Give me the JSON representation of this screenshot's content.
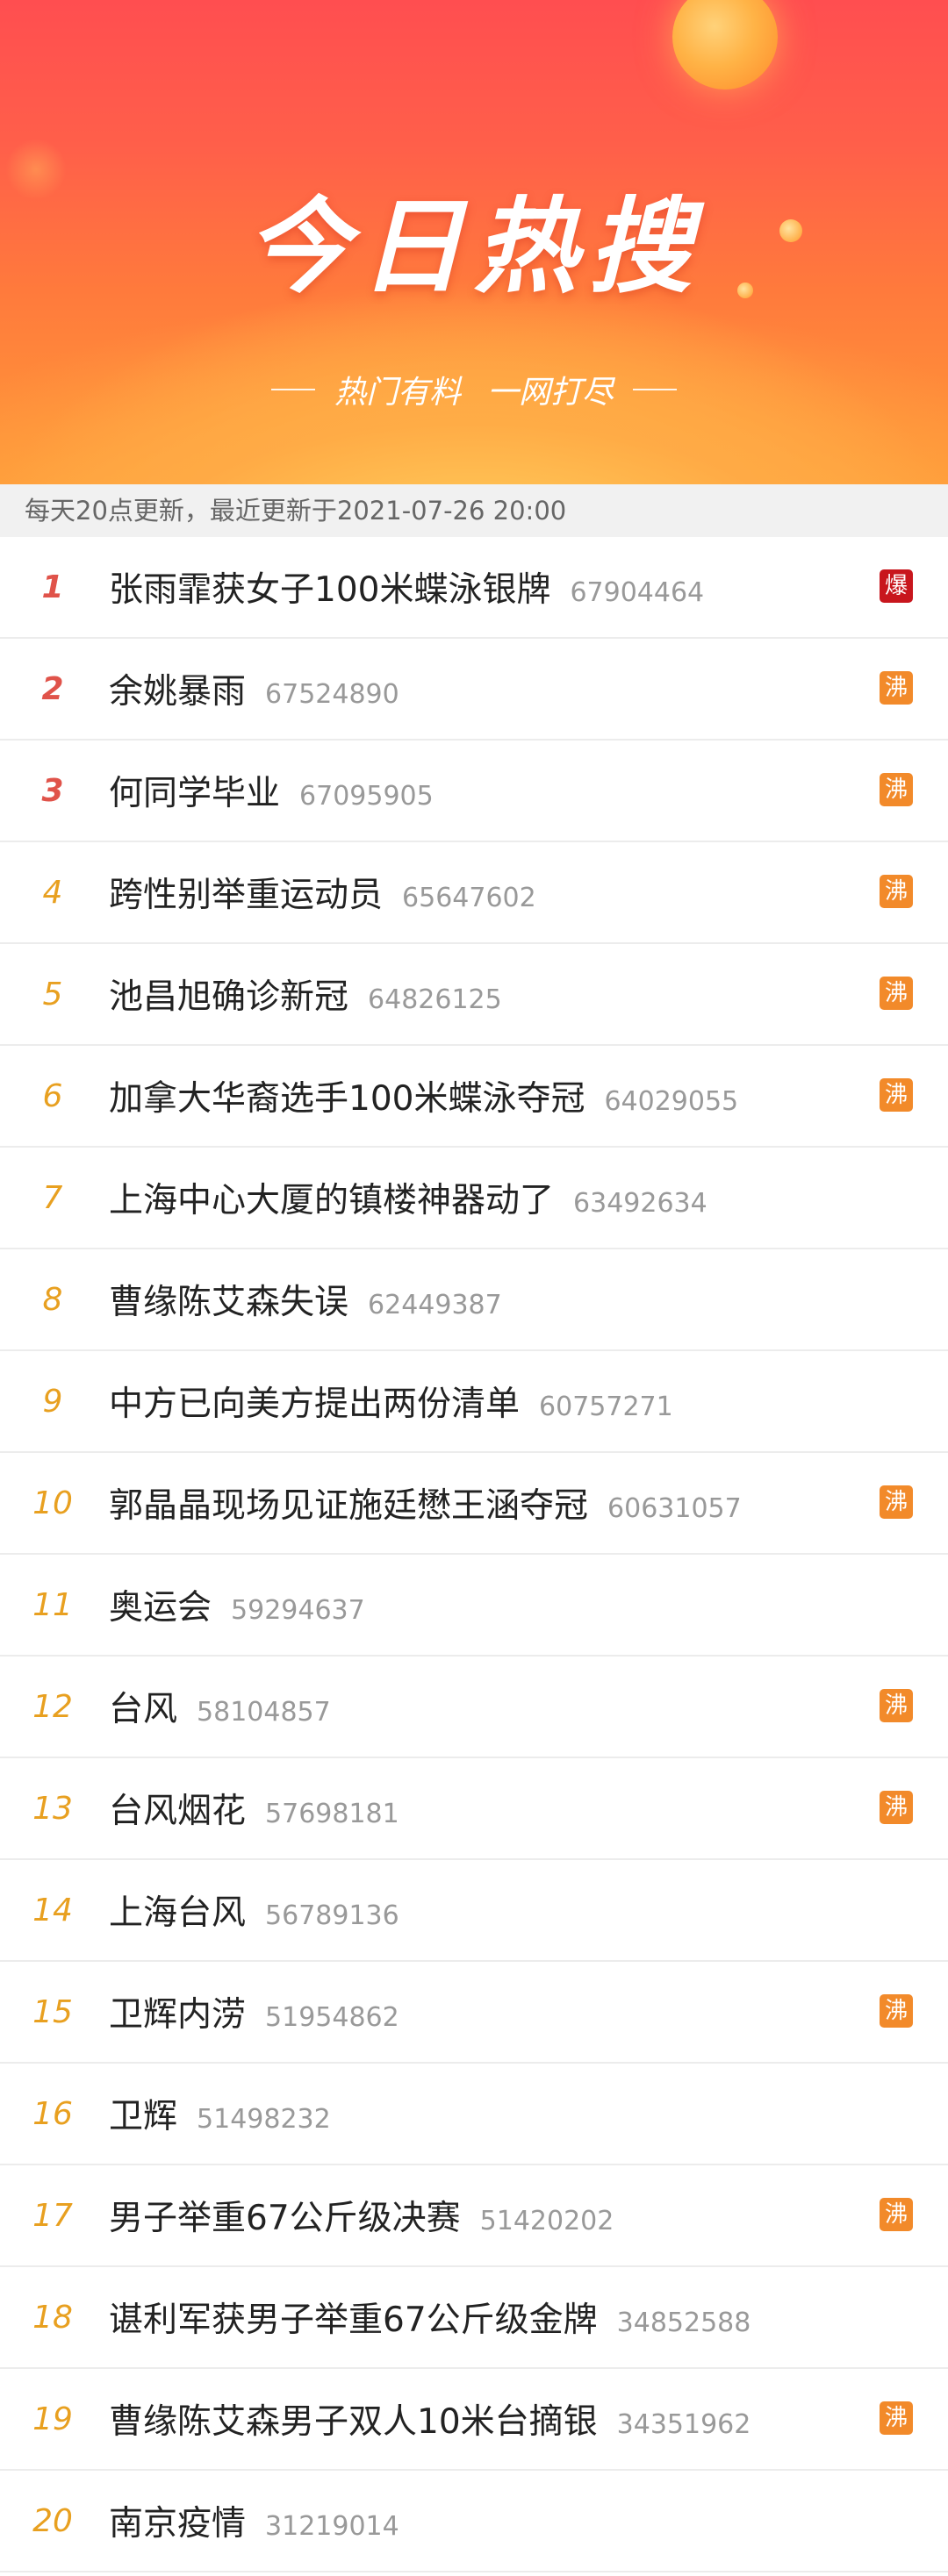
{
  "banner": {
    "title": "今日热搜",
    "subtitle_left": "热门有料",
    "subtitle_right": "一网打尽"
  },
  "update_info": "每天20点更新，最近更新于2021-07-26 20:00",
  "colors": {
    "rank_top3": "#e0534a",
    "rank_rest": "#e8a020",
    "tag_hot": "#f28a2a",
    "tag_boom": "#c8161d"
  },
  "items": [
    {
      "rank": "1",
      "title": "张雨霏获女子100米蝶泳银牌",
      "count": "67904464",
      "tag": "爆"
    },
    {
      "rank": "2",
      "title": "余姚暴雨",
      "count": "67524890",
      "tag": "沸"
    },
    {
      "rank": "3",
      "title": "何同学毕业",
      "count": "67095905",
      "tag": "沸"
    },
    {
      "rank": "4",
      "title": "跨性别举重运动员",
      "count": "65647602",
      "tag": "沸"
    },
    {
      "rank": "5",
      "title": "池昌旭确诊新冠",
      "count": "64826125",
      "tag": "沸"
    },
    {
      "rank": "6",
      "title": "加拿大华裔选手100米蝶泳夺冠",
      "count": "64029055",
      "tag": "沸"
    },
    {
      "rank": "7",
      "title": "上海中心大厦的镇楼神器动了",
      "count": "63492634",
      "tag": ""
    },
    {
      "rank": "8",
      "title": "曹缘陈艾森失误",
      "count": "62449387",
      "tag": ""
    },
    {
      "rank": "9",
      "title": "中方已向美方提出两份清单",
      "count": "60757271",
      "tag": ""
    },
    {
      "rank": "10",
      "title": "郭晶晶现场见证施廷懋王涵夺冠",
      "count": "60631057",
      "tag": "沸"
    },
    {
      "rank": "11",
      "title": "奥运会",
      "count": "59294637",
      "tag": ""
    },
    {
      "rank": "12",
      "title": "台风",
      "count": "58104857",
      "tag": "沸"
    },
    {
      "rank": "13",
      "title": "台风烟花",
      "count": "57698181",
      "tag": "沸"
    },
    {
      "rank": "14",
      "title": "上海台风",
      "count": "56789136",
      "tag": ""
    },
    {
      "rank": "15",
      "title": "卫辉内涝",
      "count": "51954862",
      "tag": "沸"
    },
    {
      "rank": "16",
      "title": "卫辉",
      "count": "51498232",
      "tag": ""
    },
    {
      "rank": "17",
      "title": "男子举重67公斤级决赛",
      "count": "51420202",
      "tag": "沸"
    },
    {
      "rank": "18",
      "title": "谌利军获男子举重67公斤级金牌",
      "count": "34852588",
      "tag": ""
    },
    {
      "rank": "19",
      "title": "曹缘陈艾森男子双人10米台摘银",
      "count": "34351962",
      "tag": "沸"
    },
    {
      "rank": "20",
      "title": "南京疫情",
      "count": "31219014",
      "tag": ""
    }
  ]
}
